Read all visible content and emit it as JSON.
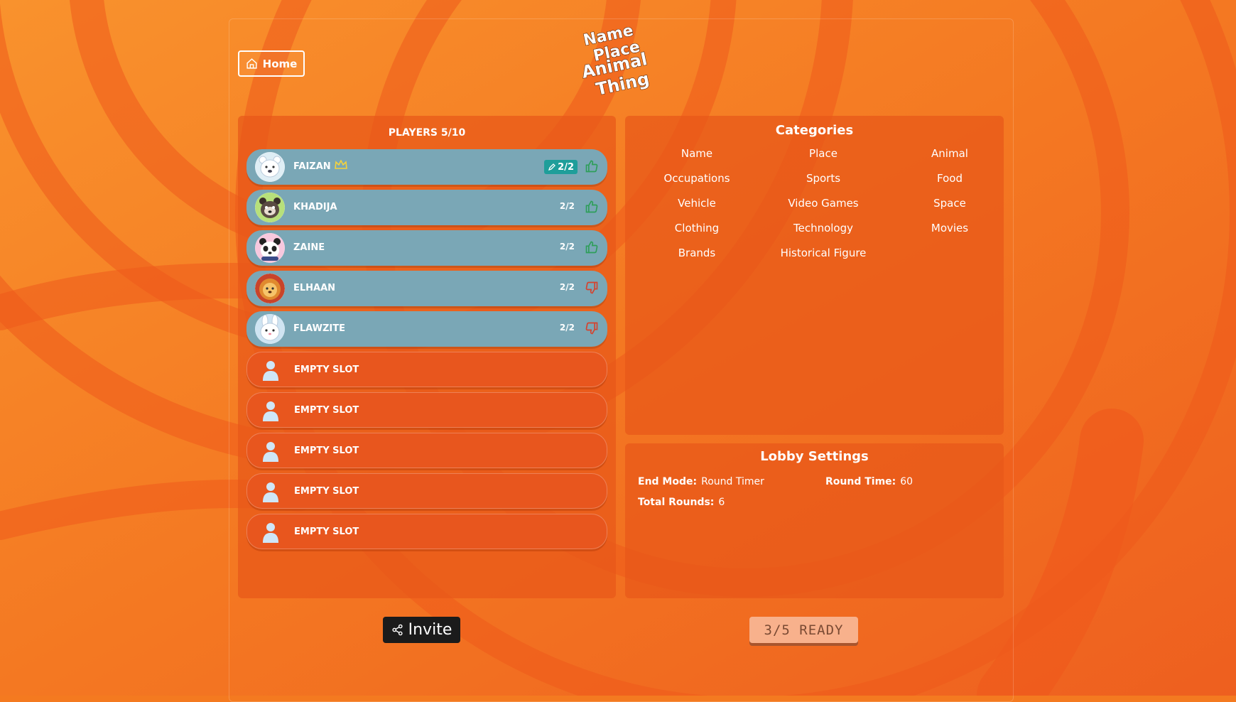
{
  "home": {
    "label": "Home"
  },
  "logo": {
    "line1": "Name",
    "line2": "Place",
    "line3": "Animal",
    "line4": "Thing"
  },
  "players": {
    "title": "PLAYERS 5/10",
    "list": [
      {
        "name": "FAIZAN",
        "score": "2/2",
        "vote": "up",
        "host": true,
        "avatar": "polar-bear"
      },
      {
        "name": "KHADIJA",
        "score": "2/2",
        "vote": "up",
        "host": false,
        "avatar": "raccoon"
      },
      {
        "name": "ZAINE",
        "score": "2/2",
        "vote": "up",
        "host": false,
        "avatar": "panda"
      },
      {
        "name": "ELHAAN",
        "score": "2/2",
        "vote": "down",
        "host": false,
        "avatar": "lion"
      },
      {
        "name": "FLAWZITE",
        "score": "2/2",
        "vote": "down",
        "host": false,
        "avatar": "rabbit"
      }
    ],
    "empty_label": "EMPTY SLOT"
  },
  "categories": {
    "title": "Categories",
    "items": [
      "Name",
      "Place",
      "Animal",
      "Occupations",
      "Sports",
      "Food",
      "Vehicle",
      "Video Games",
      "Space",
      "Clothing",
      "Technology",
      "Movies",
      "Brands",
      "Historical Figure"
    ]
  },
  "settings": {
    "title": "Lobby Settings",
    "end_mode_label": "End Mode:",
    "end_mode_value": "Round Timer",
    "round_time_label": "Round Time:",
    "round_time_value": "60",
    "total_rounds_label": "Total Rounds:",
    "total_rounds_value": "6"
  },
  "invite": {
    "label": "Invite"
  },
  "ready": {
    "label": "3/5 READY"
  },
  "colors": {
    "background": "#f47a20",
    "panel": "#e85819",
    "player_row": "#7aa7b6",
    "badge": "#1e9e9a",
    "thumb_up": "#2e9e5a",
    "thumb_down": "#d6422d",
    "invite_bg": "#1b1b1b",
    "ready_bg": "#f8b18c"
  }
}
